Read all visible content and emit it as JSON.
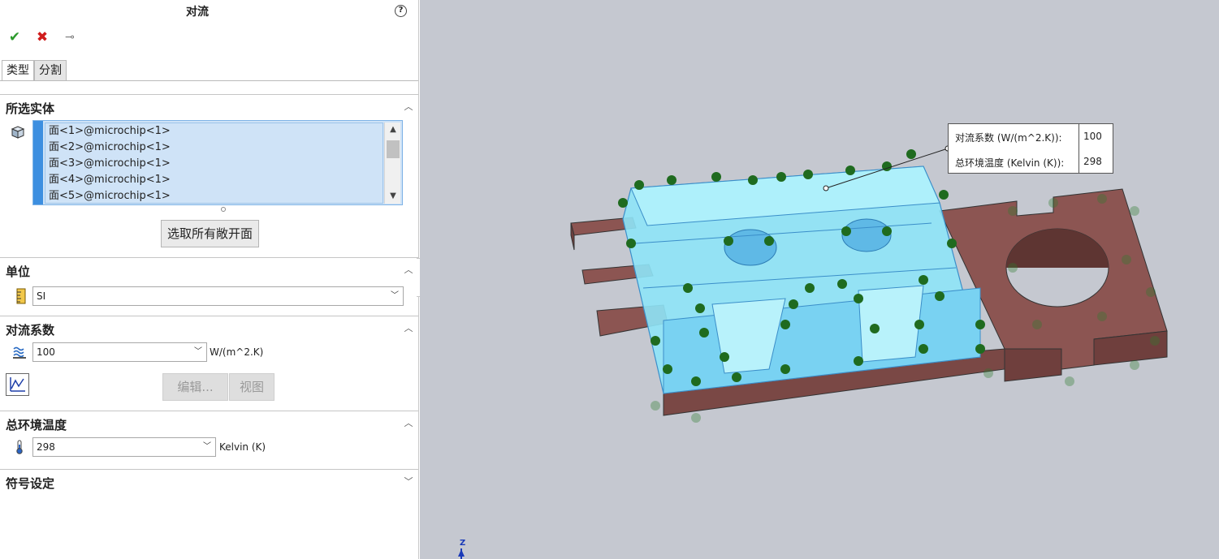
{
  "panel": {
    "title": "对流",
    "help_icon": "question-circle-icon",
    "actions": {
      "ok_glyph": "✔",
      "cancel_glyph": "✖",
      "pin_glyph": "⊸"
    },
    "tabs": [
      {
        "label": "类型"
      },
      {
        "label": "分割"
      }
    ],
    "selected_entities": {
      "header": "所选实体",
      "items": [
        "面<1>@microchip<1>",
        "面<2>@microchip<1>",
        "面<3>@microchip<1>",
        "面<4>@microchip<1>",
        "面<5>@microchip<1>"
      ],
      "select_all_button": "选取所有敞开面"
    },
    "units": {
      "header": "单位",
      "value": "SI"
    },
    "convection": {
      "header": "对流系数",
      "value": "100",
      "unit": "W/(m^2.K)",
      "edit_button": "编辑...",
      "view_button": "视图"
    },
    "ambient": {
      "header": "总环境温度",
      "value": "298",
      "unit": "Kelvin (K)"
    },
    "symbol": {
      "header": "符号设定"
    }
  },
  "viewport": {
    "callout": {
      "rows": [
        {
          "key": "对流系数 (W/(m^2.K)):",
          "value": "100"
        },
        {
          "key": "总环境温度 (Kelvin (K)):",
          "value": "298"
        }
      ]
    },
    "axis_label": "Z"
  },
  "colors": {
    "viewport_bg": "#c5c8d0",
    "part_brown": "#8c5552",
    "selected_face": "#8ee4f7",
    "arrow_green": "#1f6b1f",
    "selection_blue": "#3d8fe0"
  }
}
